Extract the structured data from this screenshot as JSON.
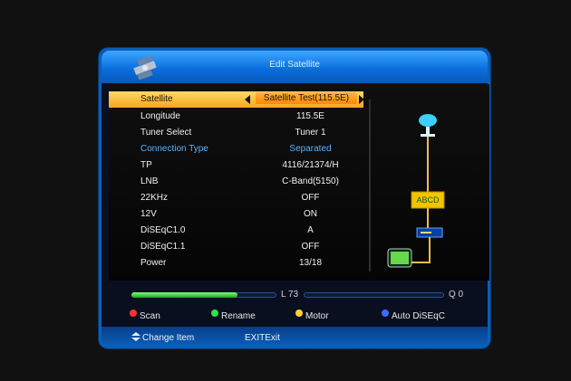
{
  "header": {
    "title": "Edit Satellite"
  },
  "rows": [
    {
      "label": "Satellite",
      "value": "Satellite Test(115.5E)"
    },
    {
      "label": "Longitude",
      "value": "115.5E"
    },
    {
      "label": "Tuner Select",
      "value": "Tuner 1"
    },
    {
      "label": "Connection Type",
      "value": "Separated"
    },
    {
      "label": "TP",
      "value": "4116/21374/H"
    },
    {
      "label": "LNB",
      "value": "C-Band(5150)"
    },
    {
      "label": "22KHz",
      "value": "OFF"
    },
    {
      "label": "12V",
      "value": "ON"
    },
    {
      "label": "DiSEqC1.0",
      "value": "A"
    },
    {
      "label": "DiSEqC1.1",
      "value": "OFF"
    },
    {
      "label": "Power",
      "value": "13/18"
    }
  ],
  "signal": {
    "level_label": "L 73",
    "quality_label": "Q 0",
    "level_value": 73,
    "quality_value": 0
  },
  "legend": {
    "red": "Scan",
    "green": "Rename",
    "yellow": "Motor",
    "blue": "Auto DiSEqC"
  },
  "footer": {
    "change_item": "Change Item",
    "exit_label": "EXIT",
    "exit_text": "Exit"
  },
  "diseqc_letters": "ABCD",
  "colors": {
    "accent": "#0b5fb9",
    "selected": "#f4a71a",
    "highlight": "#59b4ff"
  }
}
